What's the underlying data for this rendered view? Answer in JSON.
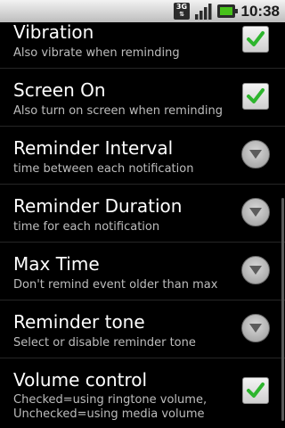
{
  "status_bar": {
    "network": "3G",
    "time": "10:38"
  },
  "preferences": [
    {
      "title": "Vibration",
      "summary": "Also vibrate when reminding",
      "widget": "checkbox",
      "checked": true
    },
    {
      "title": "Screen On",
      "summary": "Also turn on screen when reminding",
      "widget": "checkbox",
      "checked": true
    },
    {
      "title": "Reminder Interval",
      "summary": "time between each notification",
      "widget": "dropdown"
    },
    {
      "title": "Reminder Duration",
      "summary": "time for each notification",
      "widget": "dropdown"
    },
    {
      "title": "Max Time",
      "summary": "Don't remind event older than max",
      "widget": "dropdown"
    },
    {
      "title": "Reminder tone",
      "summary": "Select or disable reminder tone",
      "widget": "dropdown"
    },
    {
      "title": "Volume control",
      "summary_line1": "Checked=using ringtone volume,",
      "summary_line2": "Unchecked=using media volume",
      "widget": "checkbox",
      "checked": true
    }
  ],
  "colors": {
    "check_green": "#2db52d",
    "summary_gray": "#bdbdbd",
    "divider": "#262626"
  }
}
